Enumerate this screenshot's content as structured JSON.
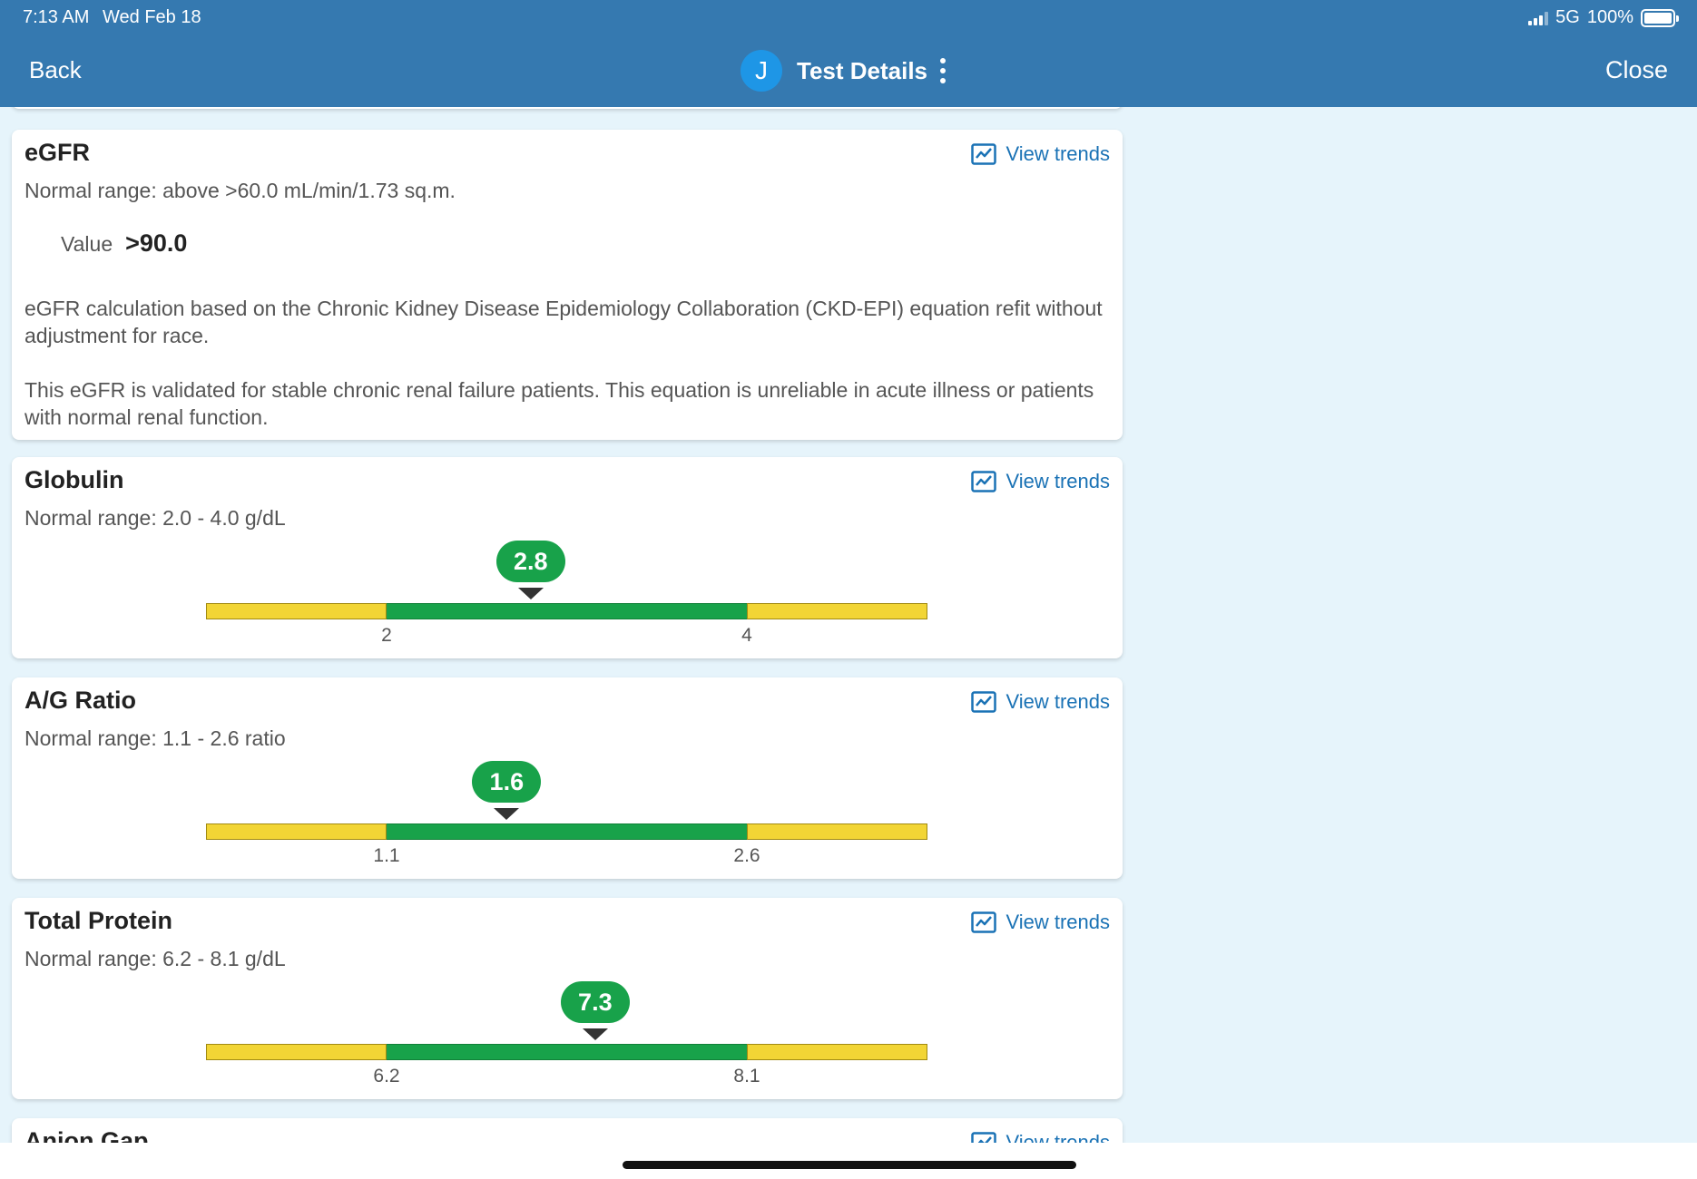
{
  "status_bar": {
    "time": "7:13 AM",
    "date": "Wed Feb 18",
    "network": "5G",
    "battery": "100%"
  },
  "header": {
    "back_label": "Back",
    "avatar_initial": "J",
    "title": "Test Details",
    "close_label": "Close",
    "color": "#3579b0"
  },
  "colors": {
    "in_range": "#18a24a",
    "out_of_range": "#f2d535",
    "link": "#1a72b5",
    "background": "#e6f4fb"
  },
  "cards": [
    {
      "title": "eGFR",
      "range": "Normal range: above >60.0 mL/min/1.73 sq.m.",
      "trends_label": "View trends",
      "value_label": "Value",
      "value": ">90.0",
      "note_1": "eGFR calculation based on the Chronic Kidney Disease Epidemiology Collaboration (CKD-EPI) equation refit without adjustment for race.",
      "note_2": "This eGFR is validated for stable chronic renal failure patients. This equation is unreliable in acute illness or patients with normal renal function."
    },
    {
      "title": "Globulin",
      "range": "Normal range: 2.0 - 4.0 g/dL",
      "trends_label": "View trends",
      "value": "2.8",
      "low": "2",
      "high": "4",
      "value_num": 2.8,
      "low_num": 2,
      "high_num": 4
    },
    {
      "title": "A/G Ratio",
      "range": "Normal range: 1.1 - 2.6 ratio",
      "trends_label": "View trends",
      "value": "1.6",
      "low": "1.1",
      "high": "2.6",
      "value_num": 1.6,
      "low_num": 1.1,
      "high_num": 2.6
    },
    {
      "title": "Total Protein",
      "range": "Normal range: 6.2 - 8.1 g/dL",
      "trends_label": "View trends",
      "value": "7.3",
      "low": "6.2",
      "high": "8.1",
      "value_num": 7.3,
      "low_num": 6.2,
      "high_num": 8.1
    },
    {
      "title": "Anion Gap",
      "trends_label": "View trends"
    }
  ]
}
